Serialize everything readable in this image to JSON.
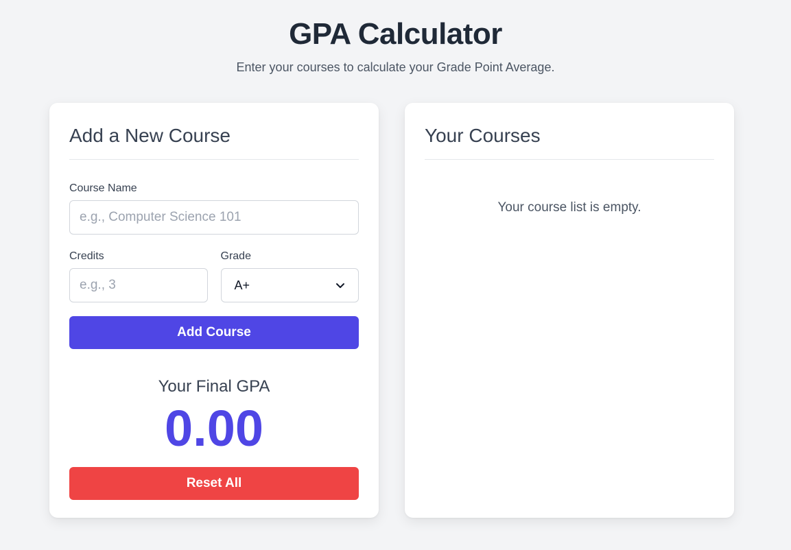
{
  "header": {
    "title": "GPA Calculator",
    "subtitle": "Enter your courses to calculate your Grade Point Average."
  },
  "add_course": {
    "title": "Add a New Course",
    "course_name_label": "Course Name",
    "course_name_placeholder": "e.g., Computer Science 101",
    "course_name_value": "",
    "credits_label": "Credits",
    "credits_placeholder": "e.g., 3",
    "credits_value": "",
    "grade_label": "Grade",
    "grade_selected": "A+",
    "add_button_label": "Add Course"
  },
  "gpa": {
    "label": "Your Final GPA",
    "value": "0.00"
  },
  "reset_button_label": "Reset All",
  "courses": {
    "title": "Your Courses",
    "empty_message": "Your course list is empty.",
    "items": []
  },
  "colors": {
    "primary": "#4f46e5",
    "danger": "#ef4444",
    "background": "#f3f4f6"
  }
}
